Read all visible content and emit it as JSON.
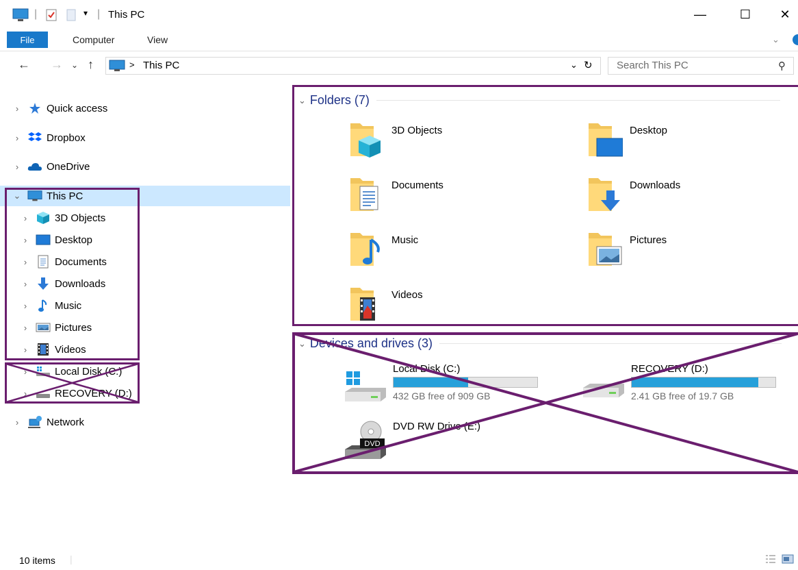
{
  "window": {
    "title": "This PC",
    "minimize_glyph": "—",
    "maximize_glyph": "☐",
    "close_glyph": "✕"
  },
  "ribbon": {
    "tabs": [
      "File",
      "Computer",
      "View"
    ]
  },
  "address": {
    "breadcrumb_sep": ">",
    "location": "This PC",
    "search_placeholder": "Search This PC"
  },
  "nav": {
    "items": [
      {
        "label": "Quick access",
        "icon": "quick-access-star-icon"
      },
      {
        "label": "Dropbox",
        "icon": "dropbox-icon"
      },
      {
        "label": "OneDrive",
        "icon": "onedrive-cloud-icon"
      },
      {
        "label": "This PC",
        "icon": "computer-monitor-icon"
      },
      {
        "label": "3D Objects",
        "icon": "3d-objects-cube-icon"
      },
      {
        "label": "Desktop",
        "icon": "desktop-icon"
      },
      {
        "label": "Documents",
        "icon": "documents-icon"
      },
      {
        "label": "Downloads",
        "icon": "downloads-arrow-icon"
      },
      {
        "label": "Music",
        "icon": "music-note-icon"
      },
      {
        "label": "Pictures",
        "icon": "pictures-icon"
      },
      {
        "label": "Videos",
        "icon": "videos-film-icon"
      },
      {
        "label": "Local Disk (C:)",
        "icon": "local-disk-icon"
      },
      {
        "label": "RECOVERY (D:)",
        "icon": "drive-icon"
      },
      {
        "label": "Network",
        "icon": "network-icon"
      }
    ]
  },
  "content": {
    "folders_header": "Folders (7)",
    "folders": [
      {
        "name": "3D Objects",
        "icon": "3d-objects-folder-icon"
      },
      {
        "name": "Desktop",
        "icon": "desktop-folder-icon"
      },
      {
        "name": "Documents",
        "icon": "documents-folder-icon"
      },
      {
        "name": "Downloads",
        "icon": "downloads-folder-icon"
      },
      {
        "name": "Music",
        "icon": "music-folder-icon"
      },
      {
        "name": "Pictures",
        "icon": "pictures-folder-icon"
      },
      {
        "name": "Videos",
        "icon": "videos-folder-icon"
      }
    ],
    "drives_header": "Devices and drives (3)",
    "drives": [
      {
        "name": "Local Disk (C:)",
        "free": "432 GB free of 909 GB",
        "used_fraction": 0.52
      },
      {
        "name": "RECOVERY (D:)",
        "free": "2.41 GB free of 19.7 GB",
        "used_fraction": 0.88
      },
      {
        "name": "DVD RW Drive (E:)",
        "dvd_label": "DVD"
      }
    ]
  },
  "status": {
    "item_count": "10 items"
  },
  "colors": {
    "accent": "#1979ca",
    "selection": "#cce8ff",
    "header_blue": "#1e3287",
    "drive_fill": "#26a0da",
    "annotation": "#6a1e6e"
  }
}
